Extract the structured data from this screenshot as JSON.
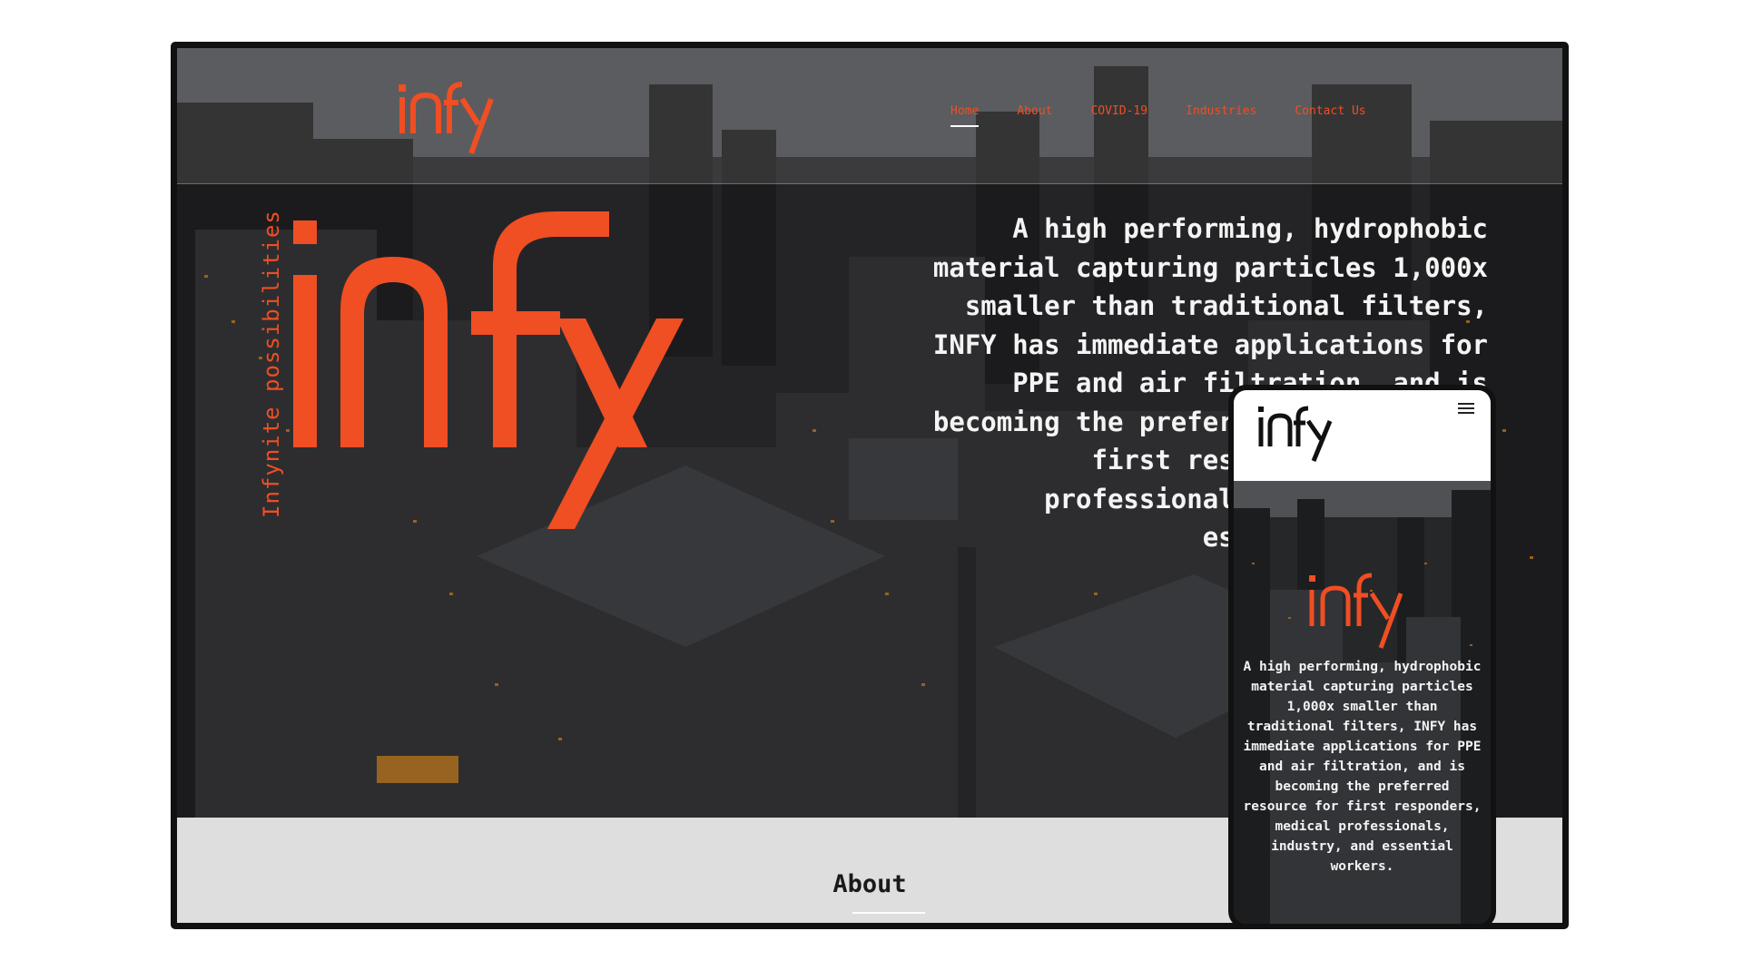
{
  "brand": {
    "name": "INFY",
    "accent_color": "#f04e23",
    "tagline": "Infynite possibilities"
  },
  "nav": {
    "items": [
      {
        "label": "Home",
        "active": true
      },
      {
        "label": "About",
        "active": false
      },
      {
        "label": "COVID-19",
        "active": false
      },
      {
        "label": "Industries",
        "active": false
      },
      {
        "label": "Contact Us",
        "active": false
      }
    ]
  },
  "hero": {
    "text": "A high performing, hydrophobic material capturing particles 1,000x smaller than traditional filters, INFY has immediate applications for PPE and air filtration, and is becoming the preferred resource for first responders, medical professionals, industry, and essential workers."
  },
  "about": {
    "heading": "About"
  },
  "mobile": {
    "menu_icon": "hamburger-icon",
    "text": "A high performing, hydrophobic material capturing particles 1,000x smaller than traditional filters, INFY has immediate applications for PPE and air filtration, and is becoming the preferred resource for first responders, medical professionals, industry, and essential workers."
  }
}
